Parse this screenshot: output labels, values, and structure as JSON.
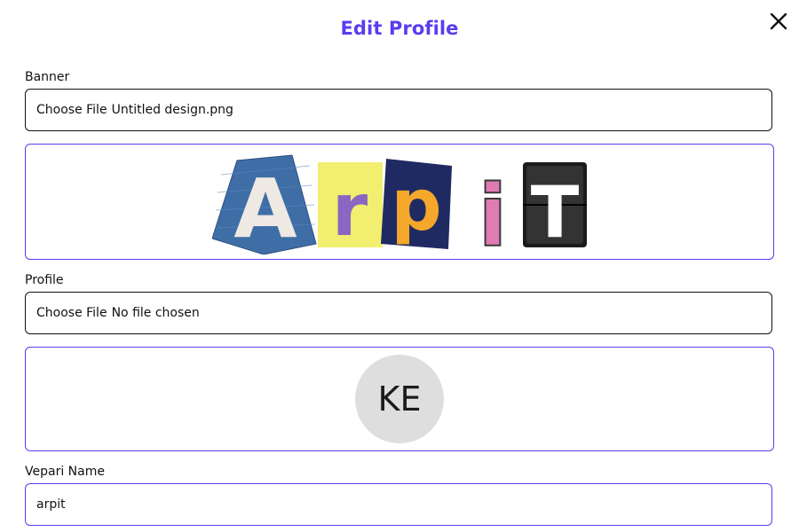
{
  "modal": {
    "title": "Edit Profile",
    "accent_color": "#5b3cf0",
    "close_icon": "close-icon"
  },
  "banner": {
    "label": "Banner",
    "file_button": "Choose File",
    "file_name": "Untitled design.png",
    "preview_text": "ArpiT"
  },
  "profile": {
    "label": "Profile",
    "file_button": "Choose File",
    "file_name": "No file chosen",
    "avatar_initials": "KE"
  },
  "vepari": {
    "label": "Vepari Name",
    "value": "arpit"
  }
}
